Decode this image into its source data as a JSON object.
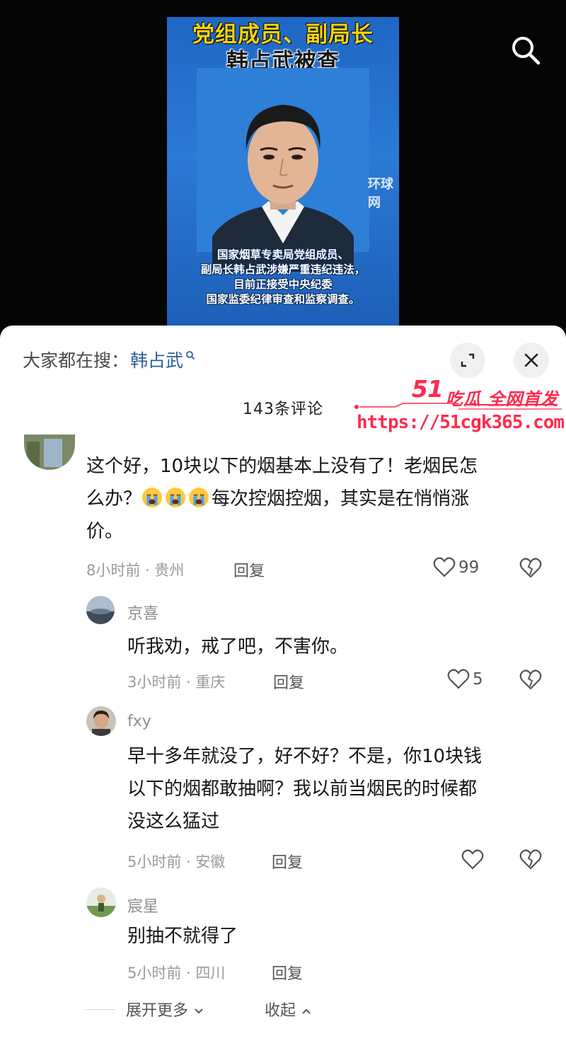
{
  "video": {
    "title_line1": "党组成员、副局长",
    "title_line2": "韩占武被查",
    "watermark": "环球网",
    "caption_lines": [
      "国家烟草专卖局党组成员、",
      "副局长韩占武涉嫌严重违纪违法，",
      "目前正接受中央纪委",
      "国家监委纪律审查和监察调查。"
    ],
    "search_icon": "search-icon"
  },
  "panel": {
    "hot_search_prefix": "大家都在搜：",
    "hot_search_keyword": "韩占武",
    "comment_count": "143条评论",
    "expand_icon": "expand-icon",
    "close_icon": "close-icon"
  },
  "brand": {
    "logo": "51",
    "title": "吃瓜 全网首发",
    "url": "https://51cgk365.com",
    "color": "#ff2a4e"
  },
  "comments": [
    {
      "lines": [
        "这个好，10块以下的烟基本上没有了！老烟民怎",
        "么办？",
        "每次控烟控烟，其实是在悄悄涨",
        "价。"
      ],
      "emoji": "crying-face-icon",
      "time_location": "8小时前 · 贵州",
      "reply": "回复",
      "likes": "99"
    },
    {
      "username": "京喜",
      "text": "听我劝，戒了吧，不害你。",
      "time_location": "3小时前 · 重庆",
      "reply": "回复",
      "likes": "5"
    },
    {
      "username": "fxy",
      "lines": [
        "早十多年就没了，好不好？不是，你10块钱",
        "以下的烟都敢抽啊？我以前当烟民的时候都",
        "没这么猛过"
      ],
      "time_location": "5小时前 · 安徽",
      "reply": "回复"
    },
    {
      "username": "宸星",
      "text": "别抽不就得了",
      "time_location": "5小时前 · 四川",
      "reply": "回复"
    }
  ],
  "footer": {
    "expand_more": "展开更多",
    "collapse": "收起"
  }
}
